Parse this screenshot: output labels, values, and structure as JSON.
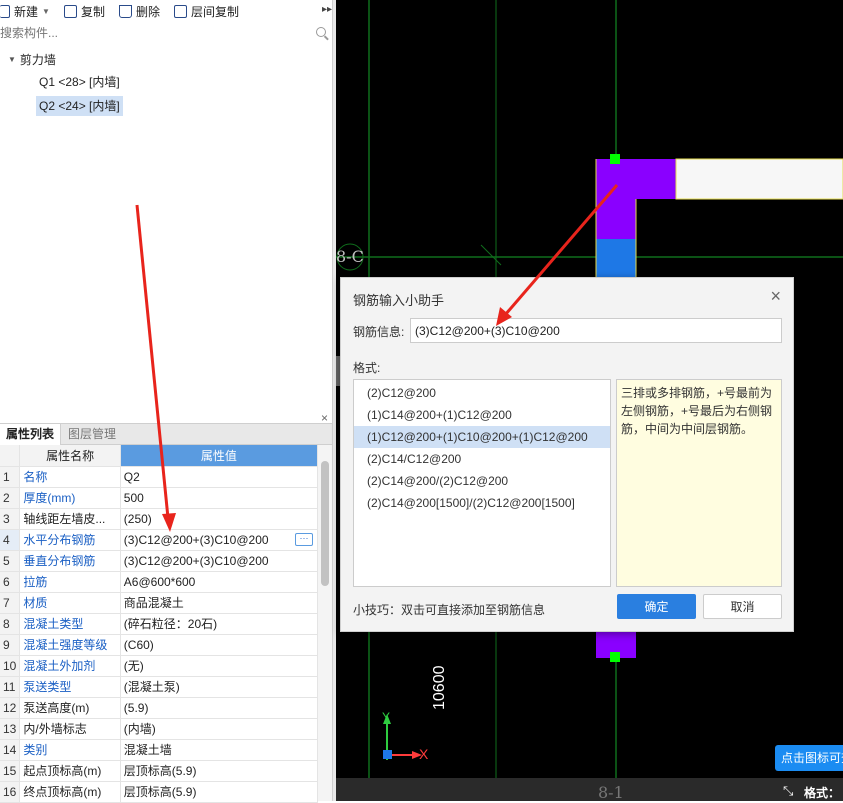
{
  "toolbar": {
    "new_label": "新建",
    "copy_label": "复制",
    "delete_label": "删除",
    "floor_copy_label": "层间复制",
    "more_glyph": "▸▸"
  },
  "search": {
    "placeholder": "搜索构件..."
  },
  "tree": {
    "group_label": "剪力墙",
    "items": [
      {
        "label": "Q1 <28> [内墙]"
      },
      {
        "label": "Q2 <24> [内墙]"
      }
    ]
  },
  "prop_panel": {
    "close_glyph": "×",
    "tabs": [
      "属性列表",
      "图层管理"
    ],
    "headers": {
      "name": "属性名称",
      "value": "属性值"
    },
    "rows": [
      {
        "idx": "1",
        "name": "名称",
        "value": "Q2"
      },
      {
        "idx": "2",
        "name": "厚度(mm)",
        "value": "500"
      },
      {
        "idx": "3",
        "name": "轴线距左墙皮...",
        "value": "(250)"
      },
      {
        "idx": "4",
        "name": "水平分布钢筋",
        "value": "(3)C12@200+(3)C10@200"
      },
      {
        "idx": "5",
        "name": "垂直分布钢筋",
        "value": "(3)C12@200+(3)C10@200"
      },
      {
        "idx": "6",
        "name": "拉筋",
        "value": "A6@600*600"
      },
      {
        "idx": "7",
        "name": "材质",
        "value": "商品混凝土"
      },
      {
        "idx": "8",
        "name": "混凝土类型",
        "value": "(碎石粒径：20石)"
      },
      {
        "idx": "9",
        "name": "混凝土强度等级",
        "value": "(C60)"
      },
      {
        "idx": "10",
        "name": "混凝土外加剂",
        "value": "(无)"
      },
      {
        "idx": "11",
        "name": "泵送类型",
        "value": "(混凝土泵)"
      },
      {
        "idx": "12",
        "name": "泵送高度(m)",
        "value": "(5.9)"
      },
      {
        "idx": "13",
        "name": "内/外墙标志",
        "value": "(内墙)"
      },
      {
        "idx": "14",
        "name": "类别",
        "value": "混凝土墙"
      },
      {
        "idx": "15",
        "name": "起点顶标高(m)",
        "value": "层顶标高(5.9)"
      },
      {
        "idx": "16",
        "name": "终点顶标高(m)",
        "value": "层顶标高(5.9)"
      }
    ],
    "more_glyph": "···"
  },
  "canvas": {
    "axis_label_left": "8-C",
    "axis_label_bottom": "8-1",
    "dimension": "10600",
    "axis_y": "Y",
    "axis_x": "X",
    "tip_text": "点击图标可查",
    "format_status": "格式：",
    "fullscreen_glyph": "⤡",
    "colors": {
      "background": "#000000",
      "grid": "#0f6e1c",
      "wall_purple": "#8a00ff",
      "wall_blue": "#1e78e6",
      "grip": "#00ff00"
    }
  },
  "dialog": {
    "title": "钢筋输入小助手",
    "close_glyph": "×",
    "info_label": "钢筋信息:",
    "info_value": "(3)C12@200+(3)C10@200",
    "format_label": "格式:",
    "formats": [
      "(2)C12@200",
      "(1)C14@200+(1)C12@200",
      "(1)C12@200+(1)C10@200+(1)C12@200",
      "(2)C14/C12@200",
      "(2)C14@200/(2)C12@200",
      "(2)C14@200[1500]/(2)C12@200[1500]"
    ],
    "description": "三排或多排钢筋，+号最前为左侧钢筋，+号最后为右侧钢筋，中间为中间层钢筋。",
    "tip": "小技巧：双击可直接添加至钢筋信息",
    "ok_label": "确定",
    "cancel_label": "取消"
  },
  "annotation_color": "#e8241c"
}
